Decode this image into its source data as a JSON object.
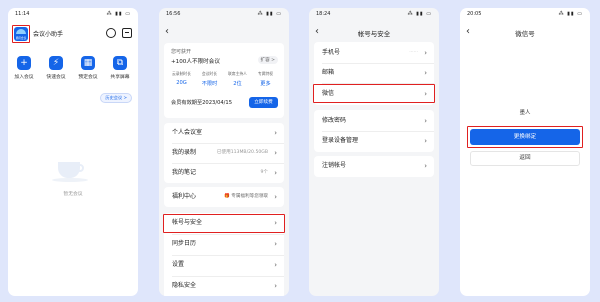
{
  "phone1": {
    "status_time": "11:14",
    "status_icons": "⁂ ▮▮ ▭",
    "app_title": "会议小助手",
    "logo_text": "腾讯会议",
    "quick_actions": [
      {
        "label": "加入会议",
        "icon": "plus-icon",
        "glyph": "+"
      },
      {
        "label": "快速会议",
        "icon": "lightning-icon",
        "glyph": "⚡"
      },
      {
        "label": "预定会议",
        "icon": "calendar-icon",
        "glyph": "▦"
      },
      {
        "label": "共享屏幕",
        "icon": "screen-share-icon",
        "glyph": "⧉"
      }
    ],
    "history_link": "历史会议 >",
    "empty_text": "暂无会议"
  },
  "phone2": {
    "status_time": "16:56",
    "status_icons": "⁂ ▮▮ ▭",
    "promo_title": "您可获开",
    "promo_line": "+100人不限时会议",
    "expand_label": "扩容 >",
    "stats": [
      {
        "label": "云录制时长",
        "value": "20G"
      },
      {
        "label": "会议时长",
        "value": "不限时"
      },
      {
        "label": "联席主持人",
        "value": "2位"
      },
      {
        "label": "专属特权",
        "value": "更多"
      }
    ],
    "expiry": "会员有效期至2023/04/15",
    "renew_button": "立即续费",
    "menu_group1": [
      {
        "label": "个人会议室",
        "meta": ""
      },
      {
        "label": "我的录制",
        "meta": "已使用113MB/20.50GB"
      },
      {
        "label": "我的笔记",
        "meta": "9个"
      }
    ],
    "welfare_label": "福利中心",
    "welfare_meta": "🎁 专属福利等您领取",
    "menu_group3": [
      {
        "label": "帐号与安全"
      },
      {
        "label": "同步日历"
      },
      {
        "label": "设置"
      },
      {
        "label": "隐私安全"
      }
    ]
  },
  "phone3": {
    "status_time": "18:24",
    "status_icons": "⁂ ▮▮ ▭",
    "title": "帐号与安全",
    "group1": [
      {
        "label": "手机号",
        "meta": "······"
      },
      {
        "label": "邮箱",
        "meta": ""
      },
      {
        "label": "微信",
        "meta": ""
      }
    ],
    "group2": [
      {
        "label": "修改密码"
      },
      {
        "label": "登录设备管理"
      }
    ],
    "group3": [
      {
        "label": "注销帐号"
      }
    ]
  },
  "phone4": {
    "status_time": "20:05",
    "status_icons": "⁂ ▮▮ ▭",
    "title": "微信号",
    "wechat_name": "墨人",
    "change_button": "更换绑定",
    "back_button": "返回"
  }
}
